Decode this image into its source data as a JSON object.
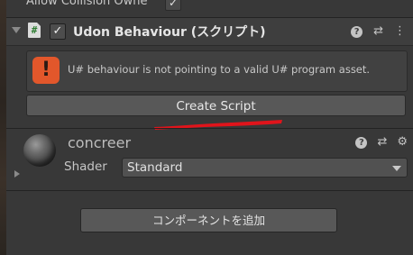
{
  "top_row": {
    "label": "Allow Collision Owne",
    "checkbox_mark": "✓"
  },
  "component": {
    "title": "Udon Behaviour (スクリプト)",
    "script_icon_glyph": "#",
    "enabled_mark": "✓",
    "help_glyph": "?",
    "preset_glyph": "⇄",
    "menu_glyph": "⋮"
  },
  "warning": {
    "icon_glyph": "!",
    "message": "U# behaviour is not pointing to a valid U# program asset.",
    "color": "#e2572b"
  },
  "create_script_button": {
    "label": "Create Script"
  },
  "annotation": {
    "underline_color": "#e0141b"
  },
  "material": {
    "name": "concreer",
    "help_glyph": "?",
    "preset_glyph": "⇄",
    "settings_glyph": "⚙",
    "shader_label": "Shader",
    "shader_value": "Standard"
  },
  "add_component_button": {
    "label": "コンポーネントを追加"
  }
}
